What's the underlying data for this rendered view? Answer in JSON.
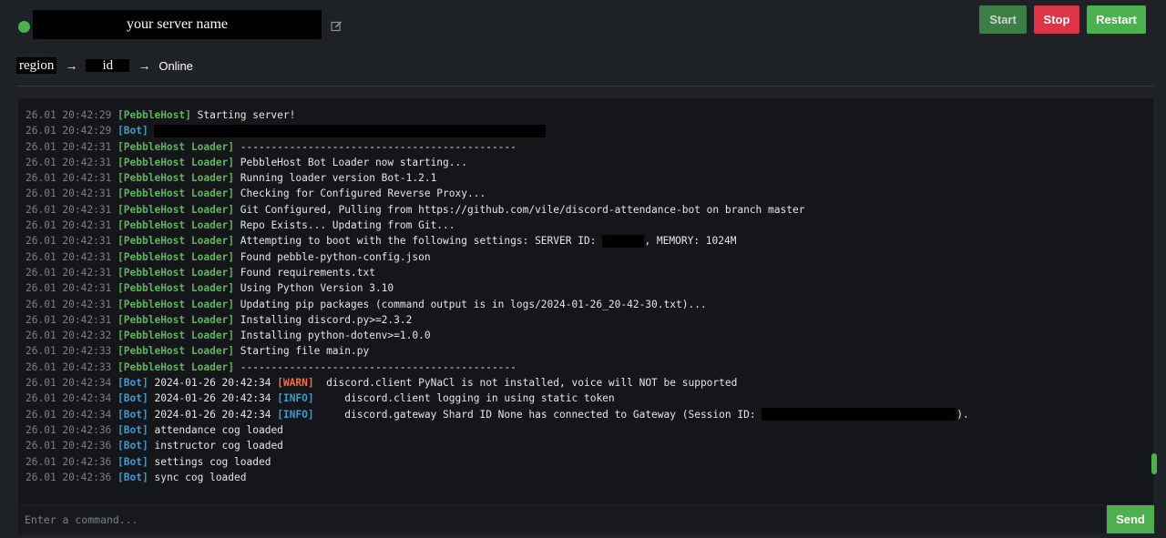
{
  "header": {
    "server_name": "your server name",
    "status_color": "#4caf50",
    "buttons": {
      "start": "Start",
      "stop": "Stop",
      "restart": "Restart"
    }
  },
  "breadcrumb": {
    "region": "region",
    "id": "id",
    "status": "Online",
    "separator": "→"
  },
  "console": {
    "lines": [
      {
        "ts": "26.01 20:42:29",
        "tag": "[PebbleHost]",
        "tag_type": "ph",
        "msg": " Starting server!"
      },
      {
        "ts": "26.01 20:42:29",
        "tag": "[Bot]",
        "tag_type": "bot",
        "msg": " ",
        "redact": 430
      },
      {
        "ts": "26.01 20:42:31",
        "tag": "[PebbleHost Loader]",
        "tag_type": "ph",
        "msg": " ---------------------------------------------"
      },
      {
        "ts": "26.01 20:42:31",
        "tag": "[PebbleHost Loader]",
        "tag_type": "ph",
        "msg": " PebbleHost Bot Loader now starting..."
      },
      {
        "ts": "26.01 20:42:31",
        "tag": "[PebbleHost Loader]",
        "tag_type": "ph",
        "msg": " Running loader version Bot-1.2.1"
      },
      {
        "ts": "26.01 20:42:31",
        "tag": "[PebbleHost Loader]",
        "tag_type": "ph",
        "msg": " Checking for Configured Reverse Proxy..."
      },
      {
        "ts": "26.01 20:42:31",
        "tag": "[PebbleHost Loader]",
        "tag_type": "ph",
        "msg": " Git Configured, Pulling from https://github.com/vile/discord-attendance-bot on branch master"
      },
      {
        "ts": "26.01 20:42:31",
        "tag": "[PebbleHost Loader]",
        "tag_type": "ph",
        "msg": " Repo Exists... Updating from Git..."
      },
      {
        "ts": "26.01 20:42:31",
        "tag": "[PebbleHost Loader]",
        "tag_type": "ph",
        "msg": " Attempting to boot with the following settings: SERVER ID:",
        "redact": 46,
        "msg_after": ", MEMORY: 1024M"
      },
      {
        "ts": "26.01 20:42:31",
        "tag": "[PebbleHost Loader]",
        "tag_type": "ph",
        "msg": " Found pebble-python-config.json"
      },
      {
        "ts": "26.01 20:42:31",
        "tag": "[PebbleHost Loader]",
        "tag_type": "ph",
        "msg": " Found requirements.txt"
      },
      {
        "ts": "26.01 20:42:31",
        "tag": "[PebbleHost Loader]",
        "tag_type": "ph",
        "msg": " Using Python Version 3.10"
      },
      {
        "ts": "26.01 20:42:31",
        "tag": "[PebbleHost Loader]",
        "tag_type": "ph",
        "msg": " Updating pip packages (command output is in logs/2024-01-26_20-42-30.txt)..."
      },
      {
        "ts": "26.01 20:42:31",
        "tag": "[PebbleHost Loader]",
        "tag_type": "ph",
        "msg": " Installing discord.py>=2.3.2"
      },
      {
        "ts": "26.01 20:42:32",
        "tag": "[PebbleHost Loader]",
        "tag_type": "ph",
        "msg": " Installing python-dotenv>=1.0.0"
      },
      {
        "ts": "26.01 20:42:33",
        "tag": "[PebbleHost Loader]",
        "tag_type": "ph",
        "msg": " Starting file main.py"
      },
      {
        "ts": "26.01 20:42:33",
        "tag": "[PebbleHost Loader]",
        "tag_type": "ph",
        "msg": " ---------------------------------------------"
      },
      {
        "ts": "26.01 20:42:34",
        "tag": "[Bot]",
        "tag_type": "bot",
        "msg": " 2024-01-26 20:42:34 ",
        "level": "[WARN]",
        "level_type": "warn",
        "msg_after": "  discord.client PyNaCl is not installed, voice will NOT be supported"
      },
      {
        "ts": "26.01 20:42:34",
        "tag": "[Bot]",
        "tag_type": "bot",
        "msg": " 2024-01-26 20:42:34 ",
        "level": "[INFO]",
        "level_type": "info",
        "msg_after": "     discord.client logging in using static token"
      },
      {
        "ts": "26.01 20:42:34",
        "tag": "[Bot]",
        "tag_type": "bot",
        "msg": " 2024-01-26 20:42:34 ",
        "level": "[INFO]",
        "level_type": "info",
        "msg_after": "     discord.gateway Shard ID None has connected to Gateway (Session ID: ",
        "redact": 214,
        "msg_end": ")."
      },
      {
        "ts": "26.01 20:42:36",
        "tag": "[Bot]",
        "tag_type": "bot",
        "msg": " attendance cog loaded"
      },
      {
        "ts": "26.01 20:42:36",
        "tag": "[Bot]",
        "tag_type": "bot",
        "msg": " instructor cog loaded"
      },
      {
        "ts": "26.01 20:42:36",
        "tag": "[Bot]",
        "tag_type": "bot",
        "msg": " settings cog loaded"
      },
      {
        "ts": "26.01 20:42:36",
        "tag": "[Bot]",
        "tag_type": "bot",
        "msg": " sync cog loaded"
      }
    ]
  },
  "command": {
    "placeholder": "Enter a command...",
    "send_label": "Send"
  }
}
